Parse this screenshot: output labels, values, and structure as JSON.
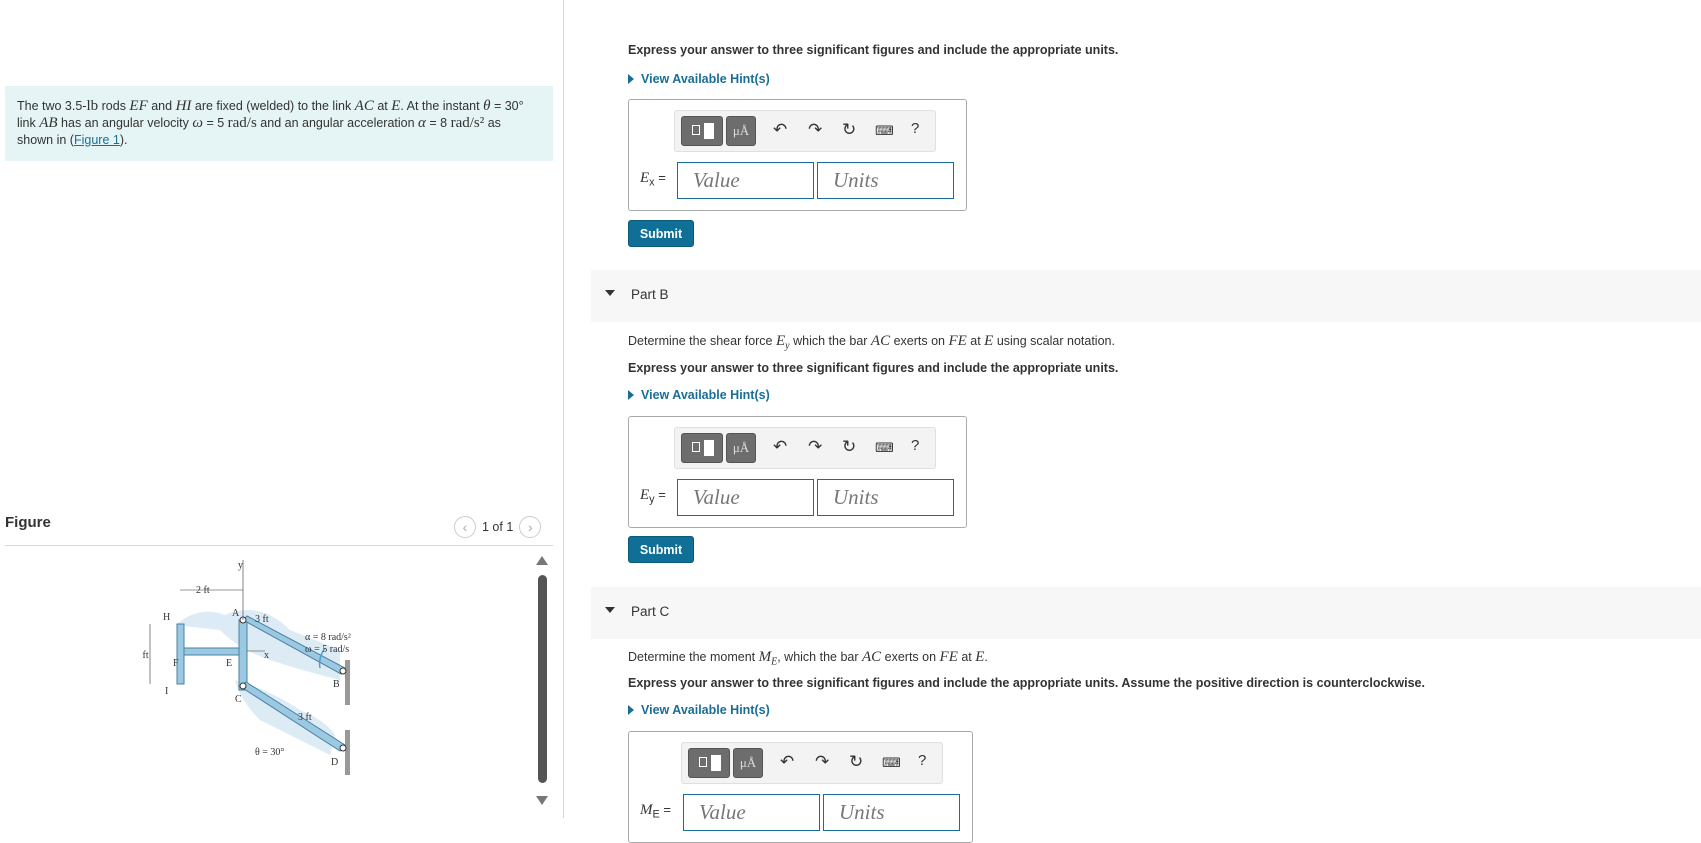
{
  "problem": {
    "text_1": "The two 3.5-",
    "unit_lb": "lb",
    "text_2": " rods ",
    "rod1": "EF",
    "text_3": " and ",
    "rod2": "HI",
    "text_4": " are fixed (welded) to the link ",
    "link1": "AC",
    "text_5": " at ",
    "point_e": "E",
    "text_6": ". At the instant ",
    "theta": "θ",
    "text_7": " = 30°",
    "text_8": "link ",
    "link2": "AB",
    "text_9": " has an angular velocity ",
    "omega": "ω",
    "text_10": " = 5 ",
    "omega_unit": "rad/s",
    "text_11": " and an angular acceleration ",
    "alpha": "α",
    "text_12": " = 8 ",
    "alpha_unit": "rad/s²",
    "text_13": " as",
    "text_14": "shown in (",
    "figure_link": "Figure 1",
    "text_15": ")."
  },
  "figure": {
    "title": "Figure",
    "pager": "1 of 1",
    "prev_icon": "chevron-left-icon",
    "next_icon": "chevron-right-icon",
    "labels": {
      "y": "y",
      "x": "x",
      "dim_2ft_top": "2 ft",
      "dim_2ft_left": "2 ft",
      "dim_3ft_top": "3 ft",
      "dim_3ft_bottom": "3 ft",
      "H": "H",
      "A": "A",
      "F": "F",
      "E": "E",
      "I": "I",
      "C": "C",
      "B": "B",
      "D": "D",
      "alpha_label": "α = 8 rad/s²",
      "omega_label": "ω = 5 rad/s",
      "theta_label": "θ = 30°"
    }
  },
  "part_a": {
    "instruction": "Express your answer to three significant figures and include the appropriate units.",
    "hint": "View Available Hint(s)",
    "label_var": "E",
    "label_sub": "x",
    "label_eq": " =",
    "value_placeholder": "Value",
    "units_placeholder": "Units",
    "submit": "Submit"
  },
  "part_b": {
    "title": "Part B",
    "q_1": "Determine the shear force ",
    "q_var": "E",
    "q_sub": "y",
    "q_2": " which the bar ",
    "q_bar": "AC",
    "q_3": " exerts on ",
    "q_fe": "FE",
    "q_4": " at ",
    "q_e": "E",
    "q_5": " using scalar notation.",
    "instruction": "Express your answer to three significant figures and include the appropriate units.",
    "hint": "View Available Hint(s)",
    "label_var": "E",
    "label_sub": "y",
    "label_eq": " =",
    "value_placeholder": "Value",
    "units_placeholder": "Units",
    "submit": "Submit"
  },
  "part_c": {
    "title": "Part C",
    "q_1": "Determine the moment ",
    "q_var": "M",
    "q_sub": "E",
    "q_2": ", which the bar ",
    "q_bar": "AC",
    "q_3": " exerts on ",
    "q_fe": "FE",
    "q_4": " at ",
    "q_e": "E",
    "q_5": ".",
    "instruction": "Express your answer to three significant figures and include the appropriate units. Assume the positive direction is counterclockwise.",
    "hint": "View Available Hint(s)",
    "label_var": "M",
    "label_sub": "E",
    "label_eq": " =",
    "value_placeholder": "Value",
    "units_placeholder": "Units"
  },
  "toolbar": {
    "mu_label": "μÅ",
    "help": "?",
    "icons": [
      "templates-icon",
      "units-icon",
      "undo-icon",
      "redo-icon",
      "reset-icon",
      "keyboard-icon",
      "help-icon"
    ]
  },
  "colors": {
    "accent": "#1a6e96",
    "submit": "#0f6f96",
    "problem_bg": "#e5f4f5"
  }
}
